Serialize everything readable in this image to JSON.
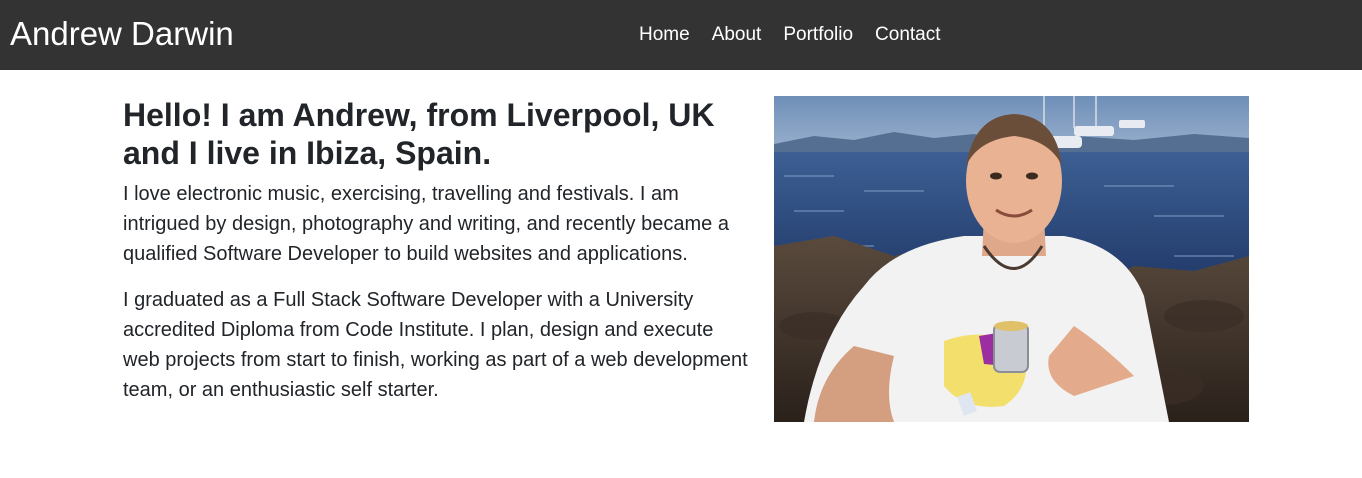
{
  "navbar": {
    "brand": "Andrew Darwin",
    "links": [
      "Home",
      "About",
      "Portfolio",
      "Contact"
    ]
  },
  "about": {
    "heading": "Hello! I am Andrew, from Liverpool, UK and I live in Ibiza, Spain.",
    "paragraphs": [
      "I love electronic music, exercising, travelling and festivals. I am intrigued by design, photography and writing, and recently became a qualified Software Developer to build websites and applications.",
      "I graduated as a Full Stack Software Developer with a University accredited Diploma from Code Institute. I plan, design and execute web projects from start to finish, working as part of a web development team, or an enthusiastic self starter."
    ]
  },
  "colors": {
    "navbar_bg": "#333333",
    "nav_text": "#ffffff",
    "body_text": "#212529"
  }
}
